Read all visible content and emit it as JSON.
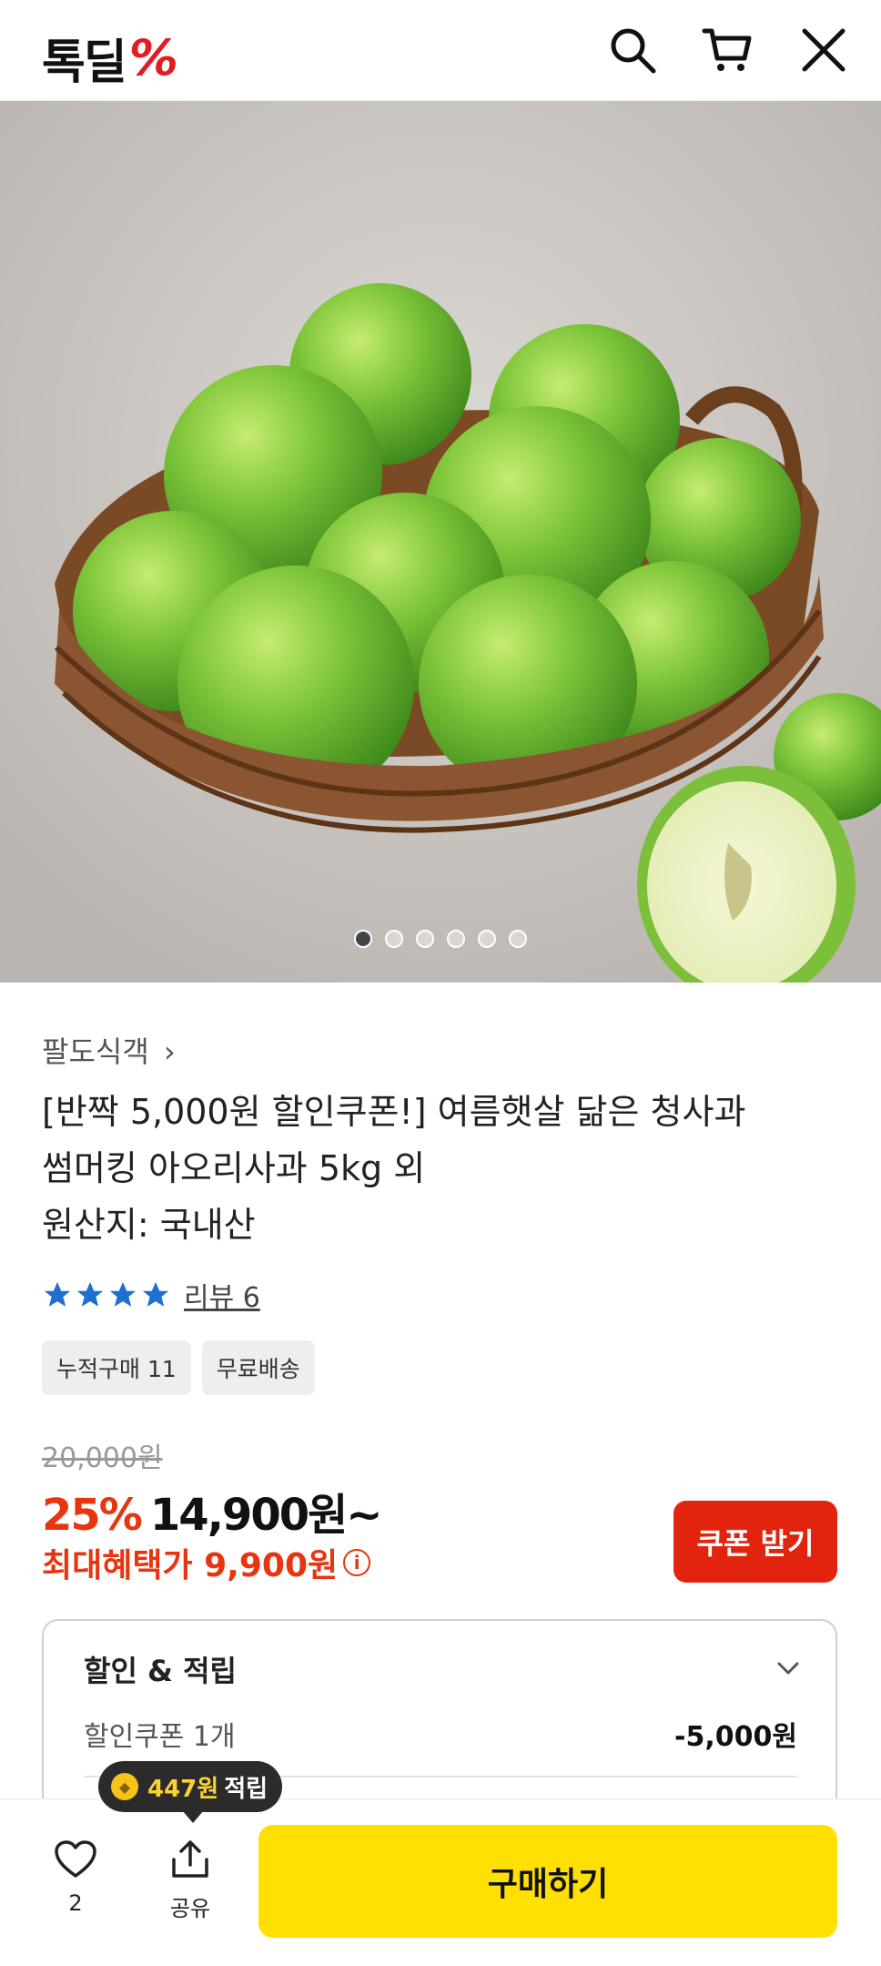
{
  "header": {
    "logo_text": "톡딜",
    "logo_mark": "%",
    "icons": [
      "search-icon",
      "cart-icon",
      "close-icon"
    ]
  },
  "hero": {
    "image_alt": "green apples in a wicker basket",
    "carousel_total": 6,
    "carousel_active": 1
  },
  "product": {
    "seller": "팔도식객",
    "title_lines": [
      "[반짝 5,000원 할인쿠폰!] 여름햇살 닮은 청사과",
      "썸머킹 아오리사과 5kg 외",
      "원산지: 국내산"
    ],
    "rating_stars": 4,
    "review_label": "리뷰 6",
    "tags": [
      "누적구매 11",
      "무료배송"
    ],
    "original_price": "20,000원",
    "discount": "25%",
    "price": "14,900원~",
    "max_benefit": "최대혜택가 9,900원",
    "coupon_button": "쿠폰 받기"
  },
  "benefits": {
    "title": "할인 & 적립",
    "row_label": "할인쿠폰 1개",
    "row_value": "-5,000원"
  },
  "bottom_bar": {
    "reward_amount": "447원",
    "reward_suffix": "적립",
    "like_count": "2",
    "share_label": "공유",
    "buy_label": "구매하기"
  },
  "colors": {
    "accent_red": "#e2240f",
    "buy_yellow": "#ffe000",
    "star_blue": "#1f6fd1"
  }
}
